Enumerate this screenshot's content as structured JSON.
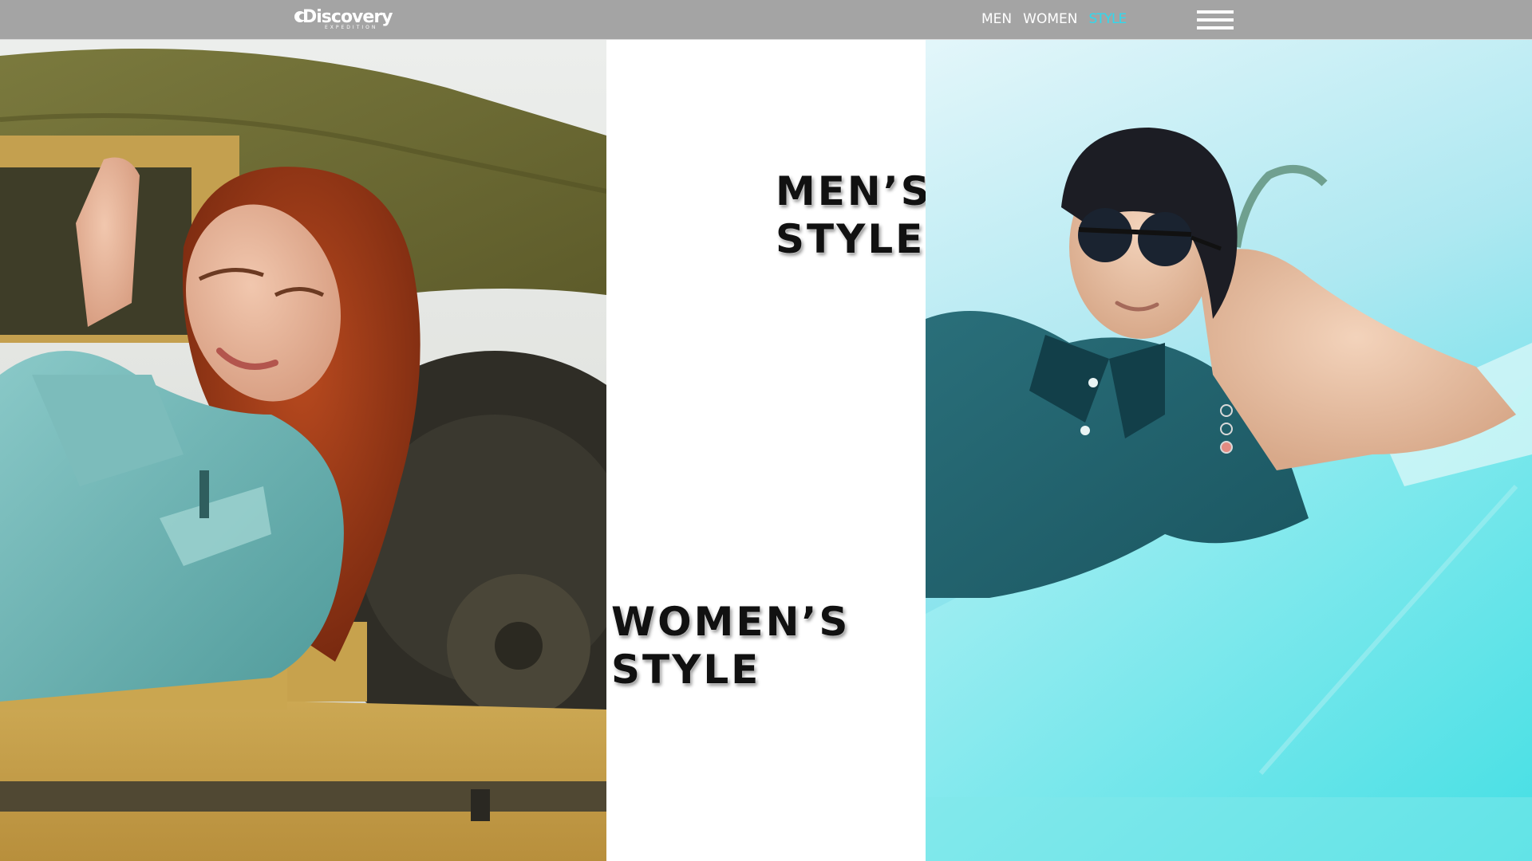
{
  "header": {
    "logo": {
      "brand": "Discovery",
      "sub": "EXPEDITION"
    },
    "nav": [
      {
        "label": "MEN",
        "active": false
      },
      {
        "label": "WOMEN",
        "active": false
      },
      {
        "label": "STYLE",
        "active": true
      }
    ],
    "menu_icon": "hamburger-menu-icon"
  },
  "headings": {
    "men": [
      "MEN’S",
      "STYLE"
    ],
    "women": [
      "WOMEN’S",
      "STYLE"
    ]
  },
  "slider": {
    "dot_count": 3,
    "active_index": 2
  },
  "colors": {
    "header_bg": "#a4a4a4",
    "nav_active": "#2fd9ee",
    "dot_active": "#e48b82",
    "men_panel_accent": "#3fe0e6",
    "women_panel_accent": "#c9a54f"
  }
}
